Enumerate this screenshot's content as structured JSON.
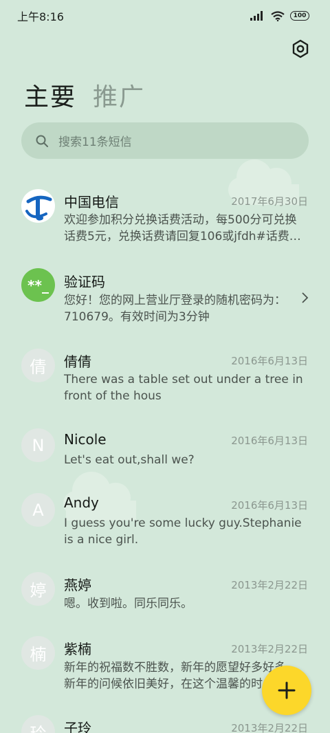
{
  "status_bar": {
    "time": "上午8:16",
    "battery": "100"
  },
  "tabs": [
    {
      "label": "主要",
      "active": true
    },
    {
      "label": "推广",
      "active": false
    }
  ],
  "search": {
    "placeholder": "搜索11条短信"
  },
  "colors": {
    "background": "#d3e8da",
    "fab": "#fcd72a",
    "accent_green": "#6cc24f"
  },
  "messages": [
    {
      "avatar_letter": "",
      "avatar_icon": "china-telecom-logo",
      "name": "中国电信",
      "date": "2017年6月30日",
      "preview": "欢迎参加积分兑换话费活动，每500分可兑换话费5元，兑换话费请回复106或jfdh#话费…"
    },
    {
      "avatar_letter": "**_",
      "avatar_icon": "verification-code-icon",
      "name": "验证码",
      "date": "",
      "preview": "您好！您的网上营业厅登录的随机密码为：710679。有效时间为3分钟"
    },
    {
      "avatar_letter": "倩",
      "name": "倩倩",
      "date": "2016年6月13日",
      "preview": "There was a table set out under a tree in front of the hous"
    },
    {
      "avatar_letter": "N",
      "name": "Nicole",
      "date": "2016年6月13日",
      "preview": "Let's eat out,shall we?"
    },
    {
      "avatar_letter": "A",
      "name": "Andy",
      "date": "2016年6月13日",
      "preview": "I guess you're some lucky guy.Stephanie is a nice girl."
    },
    {
      "avatar_letter": "婷",
      "name": "燕婷",
      "date": "2013年2月22日",
      "preview": "嗯。收到啦。同乐同乐。"
    },
    {
      "avatar_letter": "楠",
      "name": "紫楠",
      "date": "2013年2月22日",
      "preview": "新年的祝福数不胜数，新年的愿望好多好多，新年的问候依旧美好，在这个温馨的时"
    },
    {
      "avatar_letter": "玲",
      "name": "子玲",
      "date": "2013年2月22日",
      "preview": ""
    }
  ]
}
